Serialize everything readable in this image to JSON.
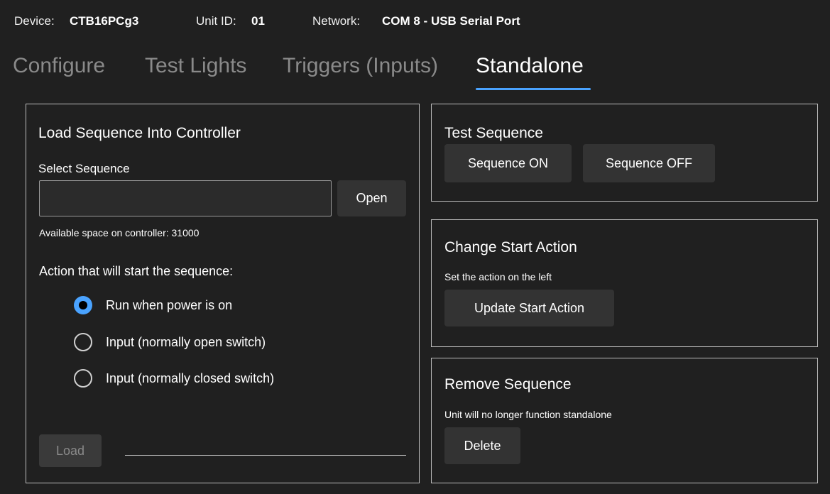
{
  "header": {
    "device_label": "Device:",
    "device_value": "CTB16PCg3",
    "unit_label": "Unit ID:",
    "unit_value": "01",
    "network_label": "Network:",
    "network_value": "COM 8 - USB Serial Port"
  },
  "tabs": [
    {
      "label": "Configure",
      "active": false
    },
    {
      "label": "Test Lights",
      "active": false
    },
    {
      "label": "Triggers (Inputs)",
      "active": false
    },
    {
      "label": "Standalone",
      "active": true
    }
  ],
  "load_panel": {
    "title": "Load Sequence Into Controller",
    "select_label": "Select Sequence",
    "sequence_path_value": "",
    "open_label": "Open",
    "available_space_text": "Available space on controller: 31000",
    "action_label": "Action that will start the sequence:",
    "options": [
      {
        "label": "Run when power is on",
        "checked": true
      },
      {
        "label": "Input (normally open switch)",
        "checked": false
      },
      {
        "label": "Input (normally closed switch)",
        "checked": false
      }
    ],
    "load_label": "Load",
    "load_enabled": false
  },
  "test_panel": {
    "title": "Test Sequence",
    "on_label": "Sequence ON",
    "off_label": "Sequence OFF"
  },
  "start_panel": {
    "title": "Change Start Action",
    "hint": "Set the action on the left",
    "update_label": "Update Start Action"
  },
  "remove_panel": {
    "title": "Remove Sequence",
    "hint": "Unit will no longer function standalone",
    "delete_label": "Delete"
  },
  "colors": {
    "background": "#202020",
    "accent": "#4aa3ff",
    "button": "#333333",
    "border": "#bdbdbd",
    "inactive_tab": "#8a8a8a"
  }
}
